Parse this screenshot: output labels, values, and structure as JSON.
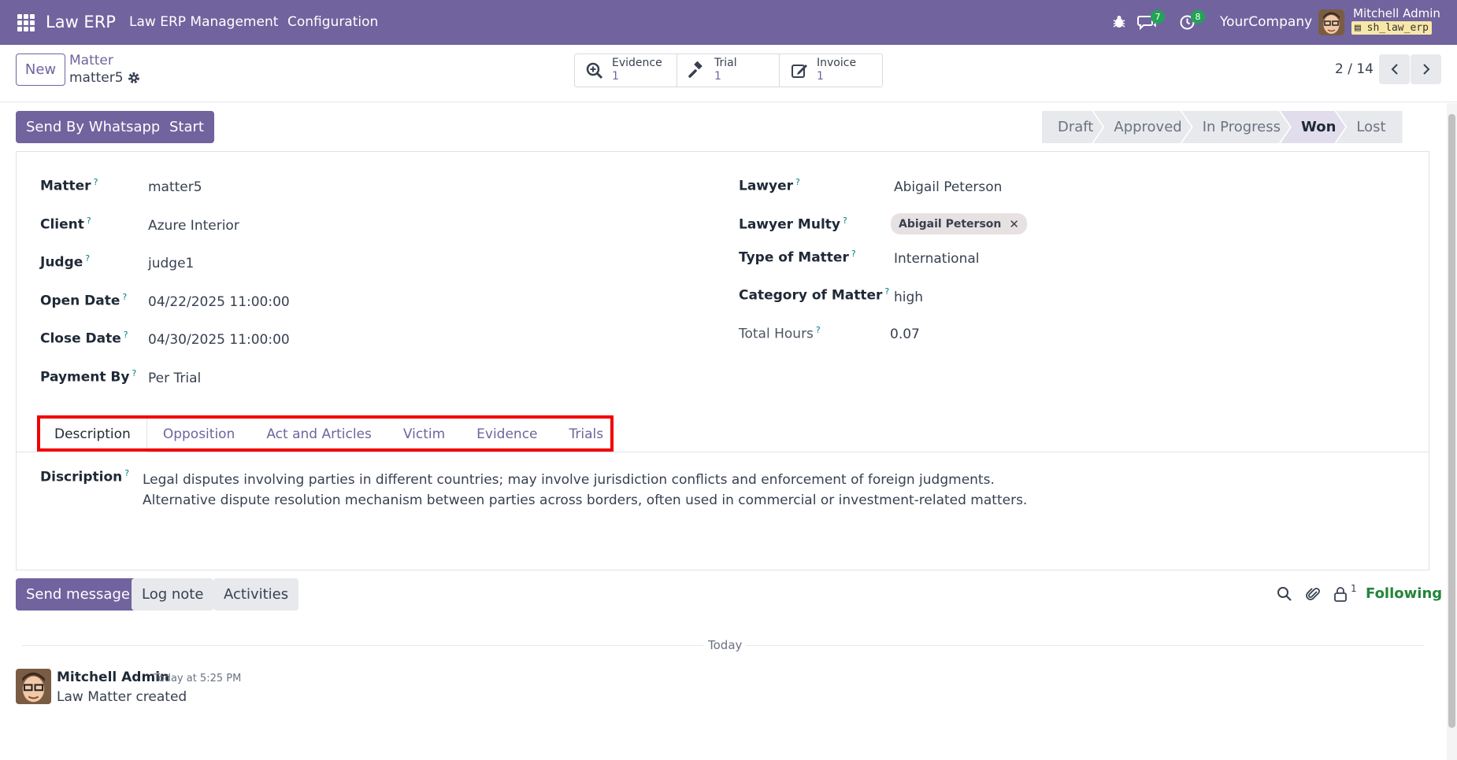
{
  "navbar": {
    "brand": "Law ERP",
    "menu": [
      "Law ERP Management",
      "Configuration"
    ],
    "messages_count": "7",
    "activities_count": "8",
    "company": "YourCompany",
    "user_name": "Mitchell Admin",
    "db_name": "sh_law_erp"
  },
  "control": {
    "new_label": "New",
    "breadcrumb_parent": "Matter",
    "breadcrumb_current": "matter5",
    "smart_buttons": [
      {
        "label": "Evidence",
        "count": "1",
        "icon": "search-plus-icon"
      },
      {
        "label": "Trial",
        "count": "1",
        "icon": "gavel-icon"
      },
      {
        "label": "Invoice",
        "count": "1",
        "icon": "edit-icon"
      }
    ],
    "pager": "2 / 14"
  },
  "actions": {
    "whatsapp_label": "Send By Whatsapp",
    "start_label": "Start"
  },
  "statusbar": {
    "stages": [
      "Draft",
      "Approved",
      "In Progress",
      "Won",
      "Lost"
    ],
    "active": "Won"
  },
  "form": {
    "left": [
      {
        "label": "Matter",
        "value": "matter5"
      },
      {
        "label": "Client",
        "value": "Azure Interior"
      },
      {
        "label": "Judge",
        "value": "judge1"
      },
      {
        "label": "Open Date",
        "value": "04/22/2025 11:00:00"
      },
      {
        "label": "Close Date",
        "value": "04/30/2025 11:00:00"
      },
      {
        "label": "Payment By",
        "value": "Per Trial"
      }
    ],
    "right": [
      {
        "label": "Lawyer",
        "value": "Abigail Peterson"
      },
      {
        "label": "Lawyer Multy",
        "value": "Abigail Peterson"
      },
      {
        "label": "Type of Matter",
        "value": "International"
      },
      {
        "label": "Category of Matter",
        "value": "high"
      },
      {
        "label": "Total Hours",
        "value": "0.07"
      }
    ],
    "help_mark": "?",
    "tabs": [
      "Description",
      "Opposition",
      "Act and Articles",
      "Victim",
      "Evidence",
      "Trials"
    ],
    "active_tab": "Description",
    "description_label": "Discription",
    "description_lines": [
      "Legal disputes involving parties in different countries; may involve jurisdiction conflicts and enforcement of foreign judgments.",
      "Alternative dispute resolution mechanism between parties across borders, often used in commercial or investment-related matters."
    ]
  },
  "chatter": {
    "send_message_label": "Send message",
    "log_note_label": "Log note",
    "activities_label": "Activities",
    "followers_count": "1",
    "following_label": "Following",
    "today_label": "Today",
    "message": {
      "author": "Mitchell Admin",
      "time": "Today at 5:25 PM",
      "body": "Law Matter created"
    }
  },
  "colors": {
    "brand": "#71639e",
    "highlight": "#f20000",
    "following": "#22863a"
  }
}
